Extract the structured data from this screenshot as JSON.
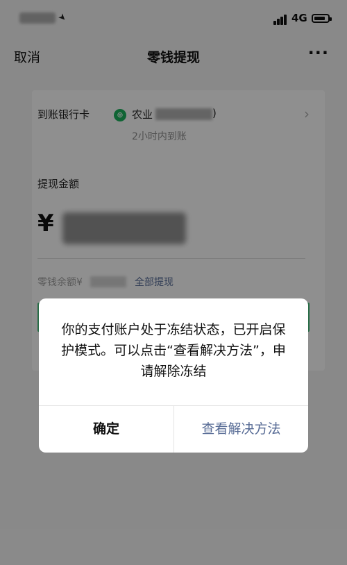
{
  "status_bar": {
    "network": "4G",
    "battery_level": 0.85,
    "icons": [
      "location-arrow-icon",
      "signal-icon",
      "battery-icon"
    ]
  },
  "nav": {
    "cancel": "取消",
    "title": "零钱提现",
    "more": "···"
  },
  "withdraw": {
    "bank_label": "到账银行卡",
    "bank_name": "农业",
    "bank_suffix": ")",
    "arrive_time": "2小时内到账",
    "amount_label": "提现金额",
    "currency": "¥",
    "balance_label": "零钱余额¥",
    "withdraw_all": "全部提现"
  },
  "dialog": {
    "message": "你的支付账户处于冻结状态，已开启保护模式。可以点击“查看解决方法”，申请解除冻结",
    "confirm": "确定",
    "view_solution": "查看解决方法"
  },
  "colors": {
    "link_blue": "#576b95",
    "wechat_green": "#1aad5a"
  }
}
